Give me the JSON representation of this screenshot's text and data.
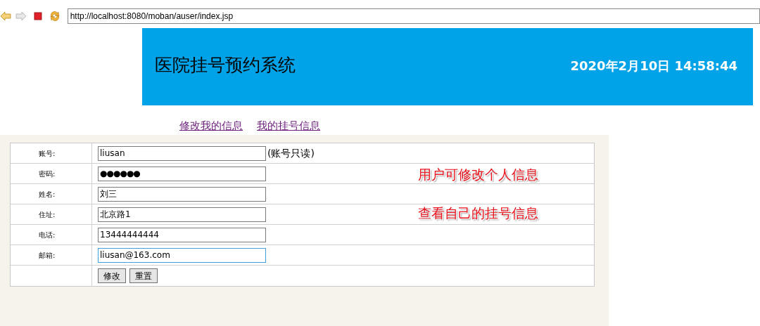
{
  "browser": {
    "url": "http://localhost:8080/moban/auser/index.jsp"
  },
  "header": {
    "title": "医院挂号预约系统",
    "datetime": "2020年2月10日 14:58:44"
  },
  "nav_links": [
    "修改我的信息",
    "我的挂号信息"
  ],
  "form": {
    "rows": [
      {
        "label": "账号:",
        "kind": "text",
        "value": "liusan",
        "note": "(账号只读)",
        "focused": false
      },
      {
        "label": "密码:",
        "kind": "password",
        "value": "●●●●●●",
        "focused": false
      },
      {
        "label": "姓名:",
        "kind": "text",
        "value": "刘三",
        "focused": false
      },
      {
        "label": "住址:",
        "kind": "text",
        "value": "北京路1",
        "focused": false
      },
      {
        "label": "电话:",
        "kind": "text",
        "value": "13444444444",
        "focused": false
      },
      {
        "label": "邮箱:",
        "kind": "text",
        "value": "liusan@163.com",
        "focused": true
      }
    ],
    "buttons": [
      "修改",
      "重置"
    ]
  },
  "annotations": [
    "用户可修改个人信息",
    "查看自己的挂号信息"
  ]
}
